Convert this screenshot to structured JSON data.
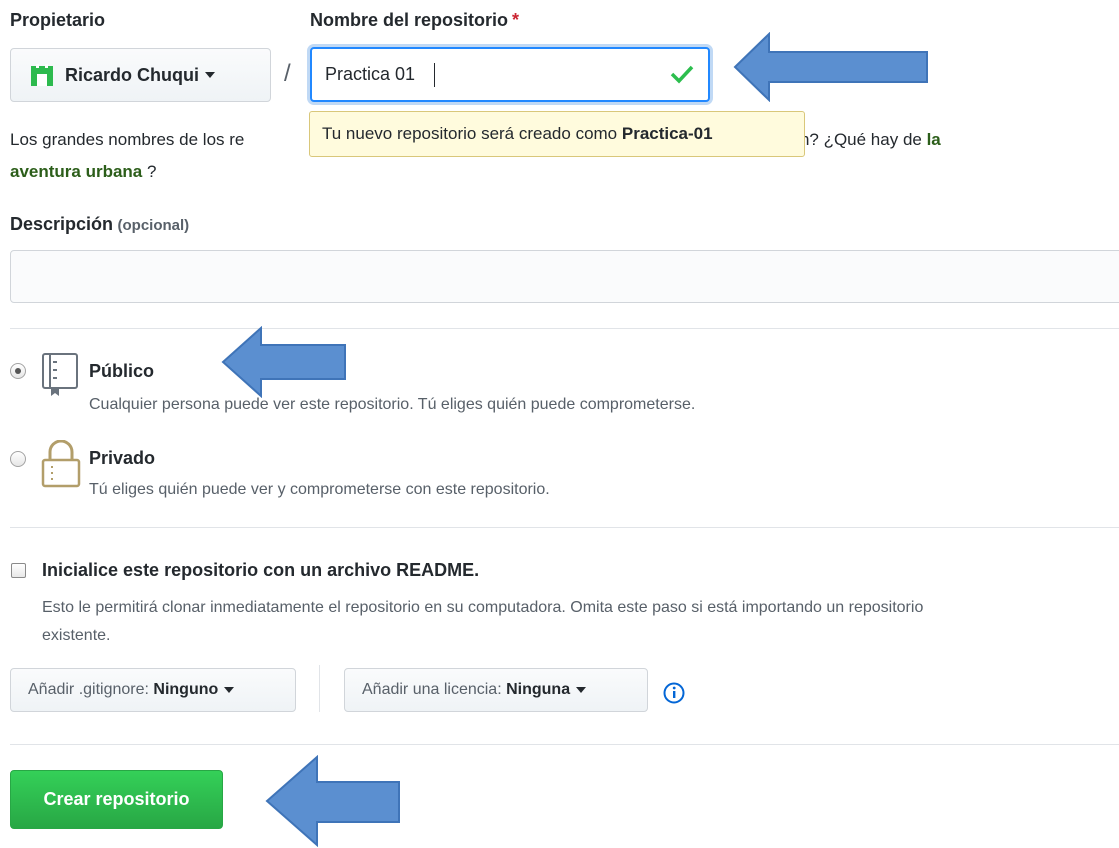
{
  "owner": {
    "label": "Propietario",
    "name": "Ricardo Chuqui"
  },
  "repo": {
    "label": "Nombre del repositorio",
    "required_mark": "*",
    "value": "Practica 01",
    "separator": "/",
    "tooltip_prefix": "Tu nuevo repositorio será creado como ",
    "tooltip_name": "Practica-01"
  },
  "suggestion": {
    "text_start": "Los grandes nombres de los re",
    "text_mid": "spiración? ¿Qué hay de ",
    "link_part1": "la",
    "link_part2": "aventura urbana",
    "text_end": " ?"
  },
  "description": {
    "label": "Descripción",
    "optional": "(opcional)",
    "value": ""
  },
  "visibility": {
    "public": {
      "title": "Público",
      "desc": "Cualquier persona puede ver este repositorio. Tú eliges quién puede comprometerse.",
      "selected": true
    },
    "private": {
      "title": "Privado",
      "desc": "Tú eliges quién puede ver y comprometerse con este repositorio.",
      "selected": false
    }
  },
  "readme": {
    "title": "Inicialice este repositorio con un archivo README.",
    "desc_line1": "Esto le permitirá clonar inmediatamente el repositorio en su computadora. Omita este paso si está importando un repositorio",
    "desc_line2": "existente.",
    "checked": false
  },
  "gitignore": {
    "prefix": "Añadir .gitignore: ",
    "value": "Ninguno"
  },
  "license": {
    "prefix": "Añadir una licencia: ",
    "value": "Ninguna"
  },
  "create_button": "Crear repositorio",
  "colors": {
    "primary": "#2ea44f",
    "arrow": "#5b8fd0",
    "tooltip_bg": "#fffbdd",
    "focus": "#2188ff"
  }
}
